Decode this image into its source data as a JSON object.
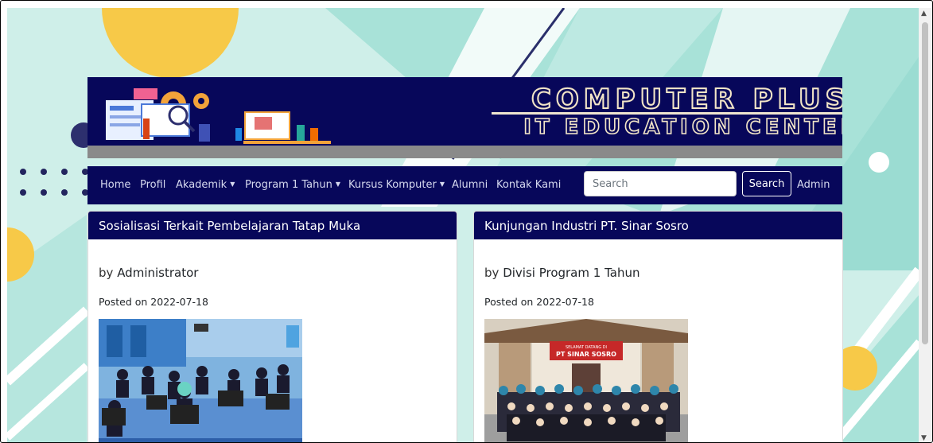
{
  "banner": {
    "title_line1": "COMPUTER PLUS",
    "title_line2": "IT EDUCATION CENTER"
  },
  "nav": {
    "items": [
      {
        "label": "Home",
        "dropdown": false
      },
      {
        "label": "Profil",
        "dropdown": false
      },
      {
        "label": "Akademik",
        "dropdown": true
      },
      {
        "label": "Program 1 Tahun",
        "dropdown": true
      },
      {
        "label": "Kursus Komputer",
        "dropdown": true
      },
      {
        "label": "Alumni",
        "dropdown": false
      },
      {
        "label": "Kontak Kami",
        "dropdown": false
      }
    ],
    "search_placeholder": "Search",
    "search_button": "Search",
    "admin_label": "Admin"
  },
  "posts": [
    {
      "title": "Sosialisasi Terkait Pembelajaran Tatap Muka",
      "by_prefix": "by",
      "author": "Administrator",
      "posted_label": "Posted on 2022-07-18"
    },
    {
      "title": "Kunjungan Industri PT. Sinar Sosro",
      "by_prefix": "by",
      "author": "Divisi Program 1 Tahun",
      "posted_label": "Posted on 2022-07-18",
      "photo_sign": {
        "line1": "SELAMAT DATANG DI",
        "line2": "PT SINAR SOSRO"
      }
    }
  ],
  "colors": {
    "navy": "#07075a",
    "background": "#cfefe9",
    "accent_yellow": "#f7c948"
  }
}
